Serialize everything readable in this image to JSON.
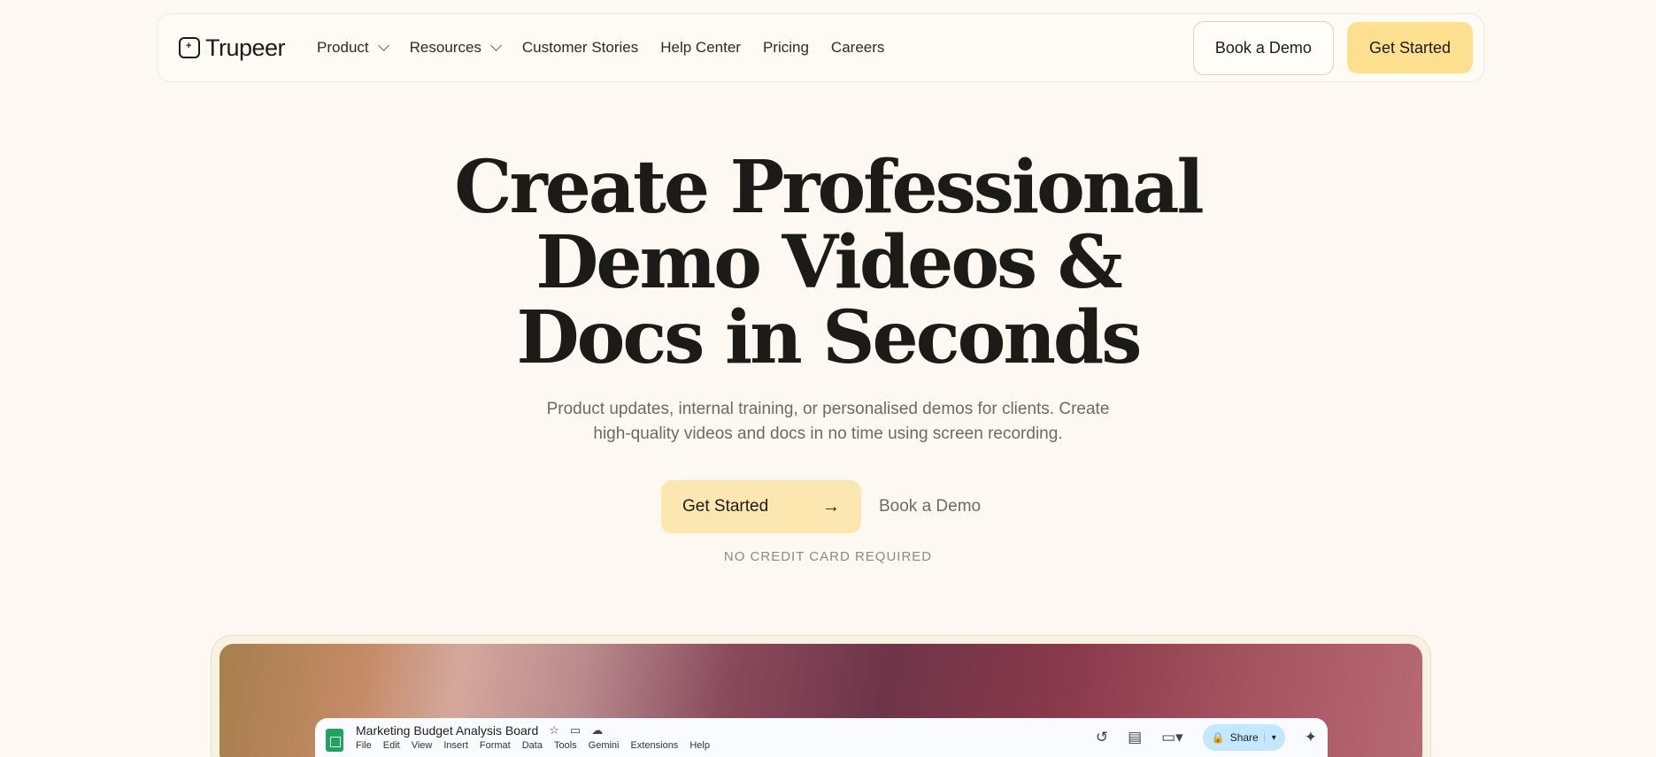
{
  "brand": {
    "name": "Trupeer"
  },
  "nav": {
    "items": [
      {
        "label": "Product",
        "has_dropdown": true
      },
      {
        "label": "Resources",
        "has_dropdown": true
      },
      {
        "label": "Customer Stories",
        "has_dropdown": false
      },
      {
        "label": "Help Center",
        "has_dropdown": false
      },
      {
        "label": "Pricing",
        "has_dropdown": false
      },
      {
        "label": "Careers",
        "has_dropdown": false
      }
    ],
    "book_demo": "Book a Demo",
    "get_started": "Get Started"
  },
  "hero": {
    "title_line1": "Create Professional",
    "title_line2": "Demo Videos &",
    "title_line3": "Docs in Seconds",
    "subtitle_line1": "Product updates, internal training, or personalised demos for clients. Create",
    "subtitle_line2": "high-quality videos and docs in no time using screen recording.",
    "cta_primary": "Get Started",
    "cta_secondary": "Book a Demo",
    "note": "NO CREDIT CARD REQUIRED"
  },
  "preview": {
    "doc_title": "Marketing Budget Analysis Board",
    "menu": [
      "File",
      "Edit",
      "View",
      "Insert",
      "Format",
      "Data",
      "Tools",
      "Gemini",
      "Extensions",
      "Help"
    ],
    "share_label": "Share"
  },
  "colors": {
    "background": "#fdf9f2",
    "accent_yellow": "#fde08f",
    "text": "#1c1b18",
    "muted": "#6d6a63"
  },
  "icons": {
    "arrow": "arrow-right-icon",
    "chevron": "chevron-down-icon"
  }
}
